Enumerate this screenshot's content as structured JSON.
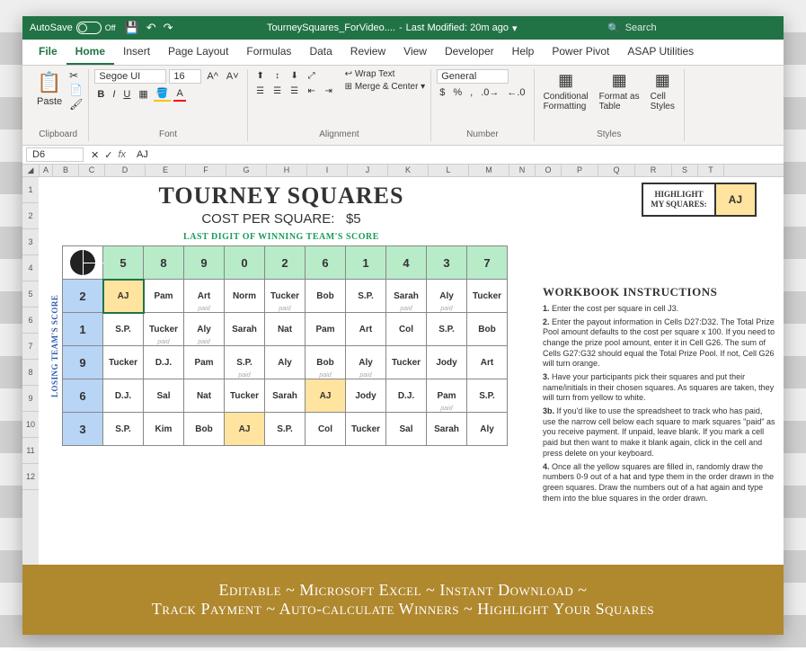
{
  "title_bar": {
    "autosave": "AutoSave",
    "autosave_state": "Off",
    "filename": "TourneySquares_ForVideo....",
    "modified": "Last Modified: 20m ago",
    "search_placeholder": "Search"
  },
  "tabs": [
    "File",
    "Home",
    "Insert",
    "Page Layout",
    "Formulas",
    "Data",
    "Review",
    "View",
    "Developer",
    "Help",
    "Power Pivot",
    "ASAP Utilities"
  ],
  "active_tab": "Home",
  "ribbon": {
    "paste": "Paste",
    "clipboard": "Clipboard",
    "font_name": "Segoe UI",
    "font_size": "16",
    "font_label": "Font",
    "wrap": "Wrap Text",
    "merge": "Merge & Center",
    "alignment": "Alignment",
    "num_format": "General",
    "number": "Number",
    "cond_fmt": "Conditional\nFormatting",
    "fmt_table": "Format as\nTable",
    "cell_styles": "Cell\nStyles",
    "styles": "Styles"
  },
  "name_box": "D6",
  "formula": "AJ",
  "columns": [
    "A",
    "B",
    "C",
    "D",
    "E",
    "F",
    "G",
    "H",
    "I",
    "J",
    "K",
    "L",
    "M",
    "N",
    "O",
    "P",
    "Q",
    "R",
    "S",
    "T"
  ],
  "rows": [
    "1",
    "2",
    "3",
    "4",
    "5",
    "6",
    "7",
    "8",
    "9",
    "10",
    "11",
    "12"
  ],
  "sheet": {
    "title": "TOURNEY SQUARES",
    "cost_label": "COST PER SQUARE:",
    "cost_value": "$5",
    "top_label": "LAST DIGIT OF WINNING TEAM'S SCORE",
    "side_label": "LOSING TEAM'S SCORE",
    "highlight_label": "HIGHLIGHT\nMY SQUARES:",
    "highlight_value": "AJ",
    "top_nums": [
      "5",
      "8",
      "9",
      "0",
      "2",
      "6",
      "1",
      "4",
      "3",
      "7"
    ],
    "left_nums": [
      "2",
      "1",
      "9",
      "6",
      "3"
    ],
    "grid": [
      [
        "AJ",
        "Pam",
        "Art",
        "Norm",
        "Tucker",
        "Bob",
        "S.P.",
        "Sarah",
        "Aly",
        "Tucker"
      ],
      [
        "S.P.",
        "Tucker",
        "Aly",
        "Sarah",
        "Nat",
        "Pam",
        "Art",
        "Col",
        "S.P.",
        "Bob"
      ],
      [
        "Tucker",
        "D.J.",
        "Pam",
        "S.P.",
        "Aly",
        "Bob",
        "Aly",
        "Tucker",
        "Jody",
        "Art"
      ],
      [
        "D.J.",
        "Sal",
        "Nat",
        "Tucker",
        "Sarah",
        "AJ",
        "Jody",
        "D.J.",
        "Pam",
        "S.P."
      ],
      [
        "S.P.",
        "Kim",
        "Bob",
        "AJ",
        "S.P.",
        "Col",
        "Tucker",
        "Sal",
        "Sarah",
        "Aly"
      ]
    ],
    "paid_cells": [
      [
        0,
        2
      ],
      [
        0,
        4
      ],
      [
        0,
        7
      ],
      [
        0,
        8
      ],
      [
        1,
        1
      ],
      [
        1,
        2
      ],
      [
        2,
        3
      ],
      [
        2,
        5
      ],
      [
        2,
        6
      ],
      [
        3,
        8
      ]
    ],
    "highlighted": [
      [
        0,
        0
      ],
      [
        3,
        5
      ],
      [
        4,
        3
      ]
    ]
  },
  "instructions": {
    "title": "WORKBOOK INSTRUCTIONS",
    "items": [
      {
        "n": "1.",
        "t": "Enter the cost per square in cell J3."
      },
      {
        "n": "2.",
        "t": "Enter the payout information in Cells D27:D32. The Total Prize Pool amount defaults to the cost per square x 100. If you need to change the prize pool amount, enter it in Cell G26. The sum of Cells G27:G32 should equal the Total Prize Pool. If not, Cell G26 will turn orange."
      },
      {
        "n": "3.",
        "t": "Have your participants pick their squares and put their name/initials in their chosen squares. As squares are taken, they will turn from yellow to white."
      },
      {
        "n": "3b.",
        "t": "If you'd like to use the spreadsheet to track who has paid, use the narrow cell below each square to mark squares \"paid\" as you receive payment. If unpaid, leave blank. If you mark a cell paid but then want to make it blank again, click in the cell and press delete on your keyboard."
      },
      {
        "n": "4.",
        "t": "Once all the yellow squares are filled in, randomly draw the numbers 0-9 out of a hat and type them in the order drawn in the green squares. Draw the numbers out of a hat again and type them into the blue squares in the order drawn."
      }
    ]
  },
  "banner": {
    "line1": "Editable ~ Microsoft Excel ~ Instant Download ~",
    "line2": "Track Payment ~ Auto-calculate Winners ~ Highlight Your Squares"
  }
}
